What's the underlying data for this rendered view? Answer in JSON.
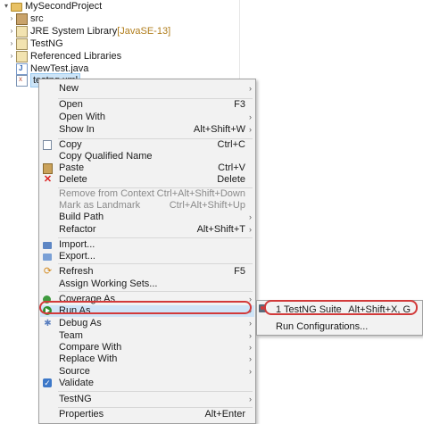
{
  "tree": {
    "project": "MySecondProject",
    "items": [
      {
        "label": "src",
        "decoration": "",
        "icon": "package-folder-icon",
        "expandable": true
      },
      {
        "label": "JRE System Library",
        "decoration": " [JavaSE-13]",
        "icon": "library-icon",
        "expandable": true
      },
      {
        "label": "TestNG",
        "decoration": "",
        "icon": "library-icon",
        "expandable": true
      },
      {
        "label": "Referenced Libraries",
        "decoration": "",
        "icon": "library-icon",
        "expandable": true
      },
      {
        "label": "NewTest.java",
        "decoration": "",
        "icon": "java-file-icon",
        "expandable": false
      },
      {
        "label": "testng.xml",
        "decoration": "",
        "icon": "xml-file-icon",
        "expandable": false,
        "selected": true
      }
    ]
  },
  "context_menu": {
    "items": [
      {
        "label": "New",
        "accel": "",
        "submenu": true
      },
      {
        "label": "Open",
        "accel": "F3"
      },
      {
        "label": "Open With",
        "accel": "",
        "submenu": true
      },
      {
        "label": "Show In",
        "accel": "Alt+Shift+W",
        "submenu": true
      },
      {
        "label": "Copy",
        "accel": "Ctrl+C",
        "icon": "copy-icon"
      },
      {
        "label": "Copy Qualified Name",
        "accel": ""
      },
      {
        "label": "Paste",
        "accel": "Ctrl+V",
        "icon": "paste-icon"
      },
      {
        "label": "Delete",
        "accel": "Delete",
        "icon": "delete-icon"
      },
      {
        "label": "Remove from Context",
        "accel": "Ctrl+Alt+Shift+Down",
        "disabled": true
      },
      {
        "label": "Mark as Landmark",
        "accel": "Ctrl+Alt+Shift+Up",
        "disabled": true
      },
      {
        "label": "Build Path",
        "accel": "",
        "submenu": true
      },
      {
        "label": "Refactor",
        "accel": "Alt+Shift+T",
        "submenu": true
      },
      {
        "label": "Import...",
        "accel": "",
        "icon": "import-icon"
      },
      {
        "label": "Export...",
        "accel": "",
        "icon": "export-icon"
      },
      {
        "label": "Refresh",
        "accel": "F5",
        "icon": "refresh-icon"
      },
      {
        "label": "Assign Working Sets...",
        "accel": ""
      },
      {
        "label": "Coverage As",
        "accel": "",
        "submenu": true,
        "icon": "coverage-icon"
      },
      {
        "label": "Run As",
        "accel": "",
        "submenu": true,
        "icon": "run-icon",
        "highlighted": true
      },
      {
        "label": "Debug As",
        "accel": "",
        "submenu": true,
        "icon": "debug-icon"
      },
      {
        "label": "Team",
        "accel": "",
        "submenu": true
      },
      {
        "label": "Compare With",
        "accel": "",
        "submenu": true
      },
      {
        "label": "Replace With",
        "accel": "",
        "submenu": true
      },
      {
        "label": "Source",
        "accel": "",
        "submenu": true
      },
      {
        "label": "Validate",
        "accel": "",
        "icon": "checkbox-icon"
      },
      {
        "label": "TestNG",
        "accel": "",
        "submenu": true
      },
      {
        "label": "Properties",
        "accel": "Alt+Enter"
      }
    ]
  },
  "run_as_submenu": {
    "items": [
      {
        "label": "1 TestNG Suite",
        "accel": "Alt+Shift+X, G",
        "icon": "testng-icon",
        "highlighted": true
      },
      {
        "label": "Run Configurations...",
        "accel": ""
      }
    ]
  },
  "colors": {
    "highlight_outline": "#d23a3a",
    "hover_background": "#cfe4f7",
    "menu_background": "#f2f2f2"
  }
}
